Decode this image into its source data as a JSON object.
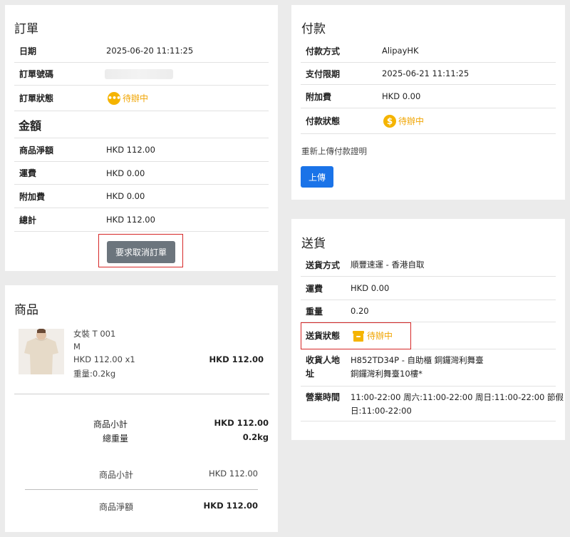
{
  "order": {
    "title": "訂單",
    "rows": [
      {
        "label": "日期",
        "value": "2025-06-20 11:11:25"
      },
      {
        "label": "訂單號碼",
        "value": ""
      },
      {
        "label": "訂單狀態",
        "value": "待辦中"
      }
    ],
    "amount_title": "金額",
    "amount_rows": [
      {
        "label": "商品淨額",
        "value": "HKD 112.00"
      },
      {
        "label": "運費",
        "value": "HKD 0.00"
      },
      {
        "label": "附加費",
        "value": "HKD 0.00"
      },
      {
        "label": "總計",
        "value": "HKD 112.00"
      }
    ],
    "cancel_button": "要求取消訂單"
  },
  "payment": {
    "title": "付款",
    "rows": [
      {
        "label": "付款方式",
        "value": "AlipayHK"
      },
      {
        "label": "支付限期",
        "value": "2025-06-21 11:11:25"
      },
      {
        "label": "附加費",
        "value": "HKD 0.00"
      },
      {
        "label": "付款狀態",
        "value": "待辦中"
      }
    ],
    "reupload_text": "重新上傳付款證明",
    "upload_button": "上傳"
  },
  "products": {
    "title": "商品",
    "item": {
      "name": "女裝 T 001",
      "size": "M",
      "price_qty": "HKD 112.00 x1",
      "weight": "重量:0.2kg",
      "total": "HKD 112.00"
    },
    "summary": [
      {
        "label": "商品小計",
        "value": "HKD 112.00"
      },
      {
        "label": "總重量",
        "value": "0.2kg"
      }
    ],
    "subtotal_label": "商品小計",
    "subtotal_value": "HKD 112.00",
    "net_label": "商品淨額",
    "net_value": "HKD 112.00"
  },
  "delivery": {
    "title": "送貨",
    "rows": [
      {
        "label": "送貨方式",
        "value": "順豐速運 - 香港自取"
      },
      {
        "label": "運費",
        "value": "HKD 0.00"
      },
      {
        "label": "重量",
        "value": "0.20"
      },
      {
        "label": "送貨狀態",
        "value": "待辦中"
      }
    ],
    "address_label_1": "收貨人地",
    "address_label_2": "址",
    "address_line_1": "H852TD34P - 自助櫃 銅鑼灣利舞臺",
    "address_line_2": "銅鑼灣利舞臺10樓*",
    "hours_label": "營業時間",
    "hours_line_1": "11:00-22:00 周六:11:00-22:00 周日:11:00-22:00 節假",
    "hours_line_2": "日:11:00-22:00"
  },
  "colors": {
    "pending": "#f0a400",
    "cancel_button": "#6c757d",
    "upload_button": "#1a73e8",
    "highlight_box": "#d62828"
  }
}
